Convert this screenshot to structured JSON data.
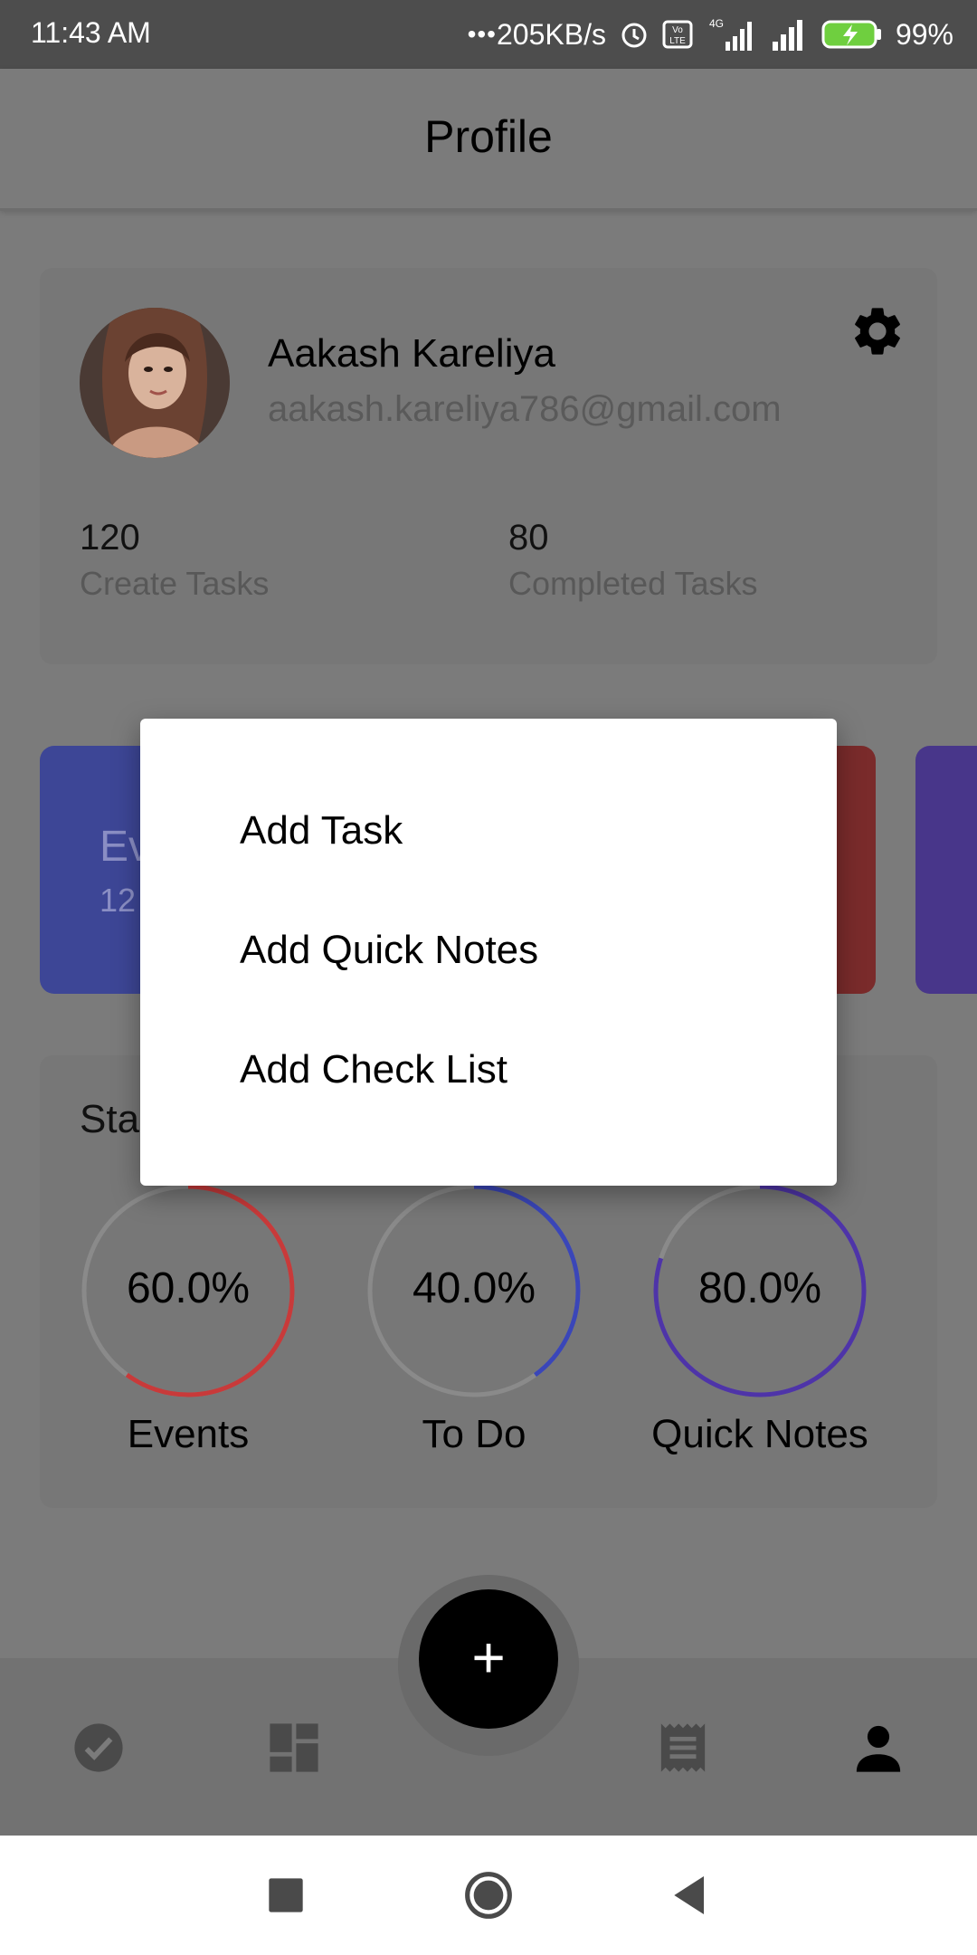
{
  "status_bar": {
    "time": "11:43 AM",
    "speed": "205KB/s",
    "battery": "99%",
    "icons": [
      "alarm-icon",
      "volte-icon",
      "signal-4g-icon",
      "signal-icon",
      "battery-charging-icon"
    ]
  },
  "app_bar": {
    "title": "Profile"
  },
  "profile": {
    "name": "Aakash Kareliya",
    "email": "aakash.kareliya786@gmail.com",
    "create_count": "120",
    "create_label": "Create Tasks",
    "completed_count": "80",
    "completed_label": "Completed Tasks",
    "settings_icon": "gear-icon"
  },
  "tiles": [
    {
      "title": "Ev",
      "count": "12",
      "color": "#3d4696"
    },
    {
      "color": "#7a2b2b"
    },
    {
      "color": "#48368a"
    }
  ],
  "statistics": {
    "title": "Sta",
    "rings": [
      {
        "value": "60.0%",
        "fraction": 0.6,
        "label": "Events",
        "color": "#c83a3a"
      },
      {
        "value": "40.0%",
        "fraction": 0.4,
        "label": "To Do",
        "color": "#3a46b8"
      },
      {
        "value": "80.0%",
        "fraction": 0.8,
        "label": "Quick Notes",
        "color": "#4e34a8"
      }
    ]
  },
  "dialog": {
    "items": [
      "Add Task",
      "Add Quick Notes",
      "Add Check List"
    ]
  },
  "fab": {
    "label": "+"
  },
  "bottom_nav": {
    "items": [
      "check-circle-icon",
      "dashboard-icon",
      "notes-icon",
      "person-icon"
    ],
    "active": "person-icon"
  },
  "system_nav": [
    "recents-icon",
    "home-icon",
    "back-icon"
  ]
}
